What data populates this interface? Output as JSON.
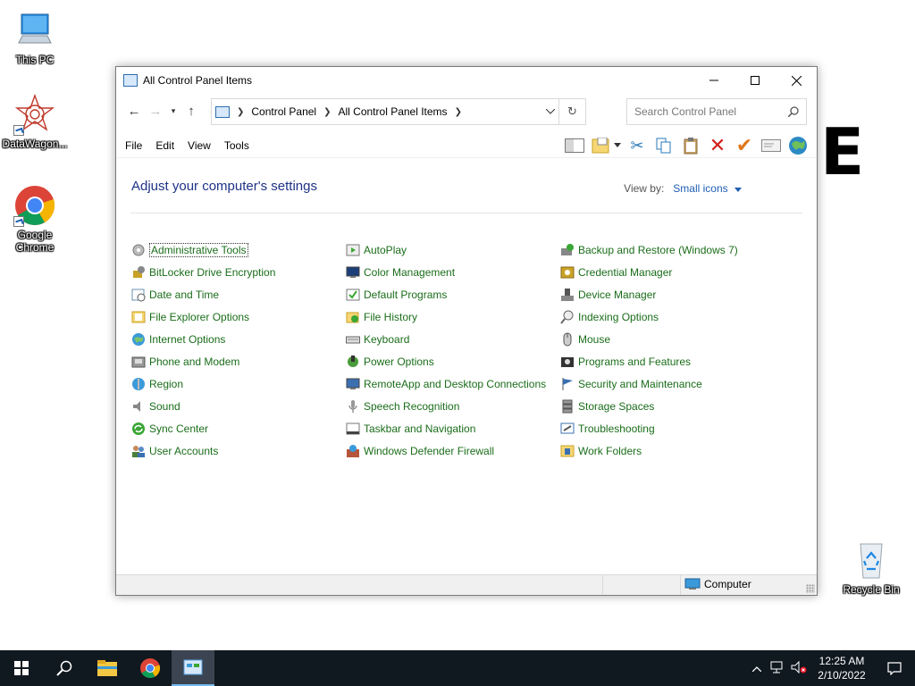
{
  "desktop": {
    "icons": [
      {
        "label": "This PC"
      },
      {
        "label": "DataWagon..."
      },
      {
        "label": "Google Chrome"
      },
      {
        "label": "Recycle Bin"
      }
    ]
  },
  "window": {
    "title": "All Control Panel Items",
    "breadcrumb": [
      "Control Panel",
      "All Control Panel Items"
    ],
    "search_placeholder": "Search Control Panel",
    "menus": [
      "File",
      "Edit",
      "View",
      "Tools"
    ],
    "heading": "Adjust your computer's settings",
    "view_by_label": "View by:",
    "view_by_value": "Small icons",
    "columns": [
      [
        "Administrative Tools",
        "BitLocker Drive Encryption",
        "Date and Time",
        "File Explorer Options",
        "Internet Options",
        "Phone and Modem",
        "Region",
        "Sound",
        "Sync Center",
        "User Accounts"
      ],
      [
        "AutoPlay",
        "Color Management",
        "Default Programs",
        "File History",
        "Keyboard",
        "Power Options",
        "RemoteApp and Desktop Connections",
        "Speech Recognition",
        "Taskbar and Navigation",
        "Windows Defender Firewall"
      ],
      [
        "Backup and Restore (Windows 7)",
        "Credential Manager",
        "Device Manager",
        "Indexing Options",
        "Mouse",
        "Programs and Features",
        "Security and Maintenance",
        "Storage Spaces",
        "Troubleshooting",
        "Work Folders"
      ]
    ],
    "status_text": "Computer"
  },
  "overlay_letter": "E",
  "taskbar": {
    "time": "12:25 AM",
    "date": "2/10/2022"
  },
  "colors": {
    "link_green": "#1a6d1a",
    "heading_blue": "#1e3287",
    "taskbar": "#101820"
  }
}
